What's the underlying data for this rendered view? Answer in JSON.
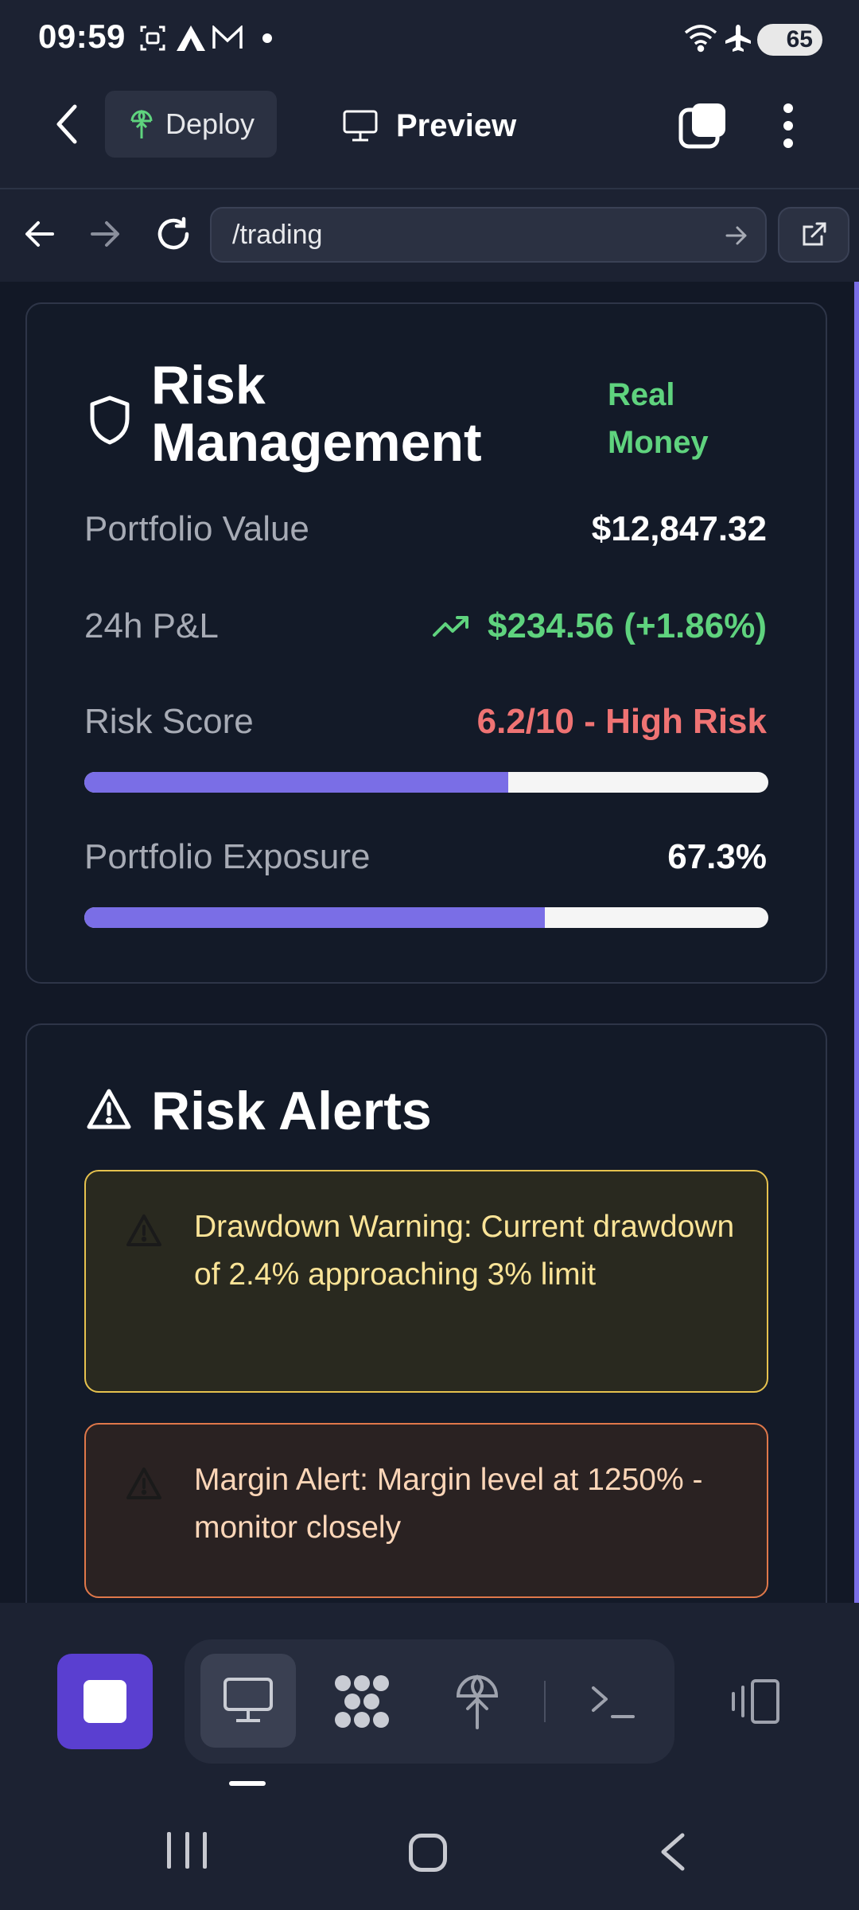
{
  "status_bar": {
    "time": "09:59",
    "battery": "65"
  },
  "app_bar": {
    "deploy_label": "Deploy",
    "preview_label": "Preview"
  },
  "url_bar": {
    "url": "/trading"
  },
  "risk_card": {
    "title_line1": "Risk",
    "title_line2": "Management",
    "badge_line1": "Real",
    "badge_line2": "Money",
    "portfolio_value_label": "Portfolio Value",
    "portfolio_value": "$12,847.32",
    "pnl_label": "24h P&L",
    "pnl_value": "$234.56 (+1.86%)",
    "risk_score_label": "Risk Score",
    "risk_score_value": "6.2/10 - High Risk",
    "risk_score_fraction": 0.62,
    "exposure_label": "Portfolio Exposure",
    "exposure_value": "67.3%",
    "exposure_fraction": 0.673
  },
  "alerts_card": {
    "title": "Risk Alerts",
    "alerts": [
      {
        "text": "Drawdown Warning: Current drawdown of 2.4% approaching 3% limit"
      },
      {
        "text": "Margin Alert: Margin level at 1250% - monitor closely"
      }
    ]
  },
  "colors": {
    "accent": "#7a6ee6",
    "positive": "#5fd37e",
    "danger": "#ef7373",
    "warning_border": "#e6c24e",
    "alert_border": "#e0784a",
    "stop_button": "#5a3fd0"
  }
}
